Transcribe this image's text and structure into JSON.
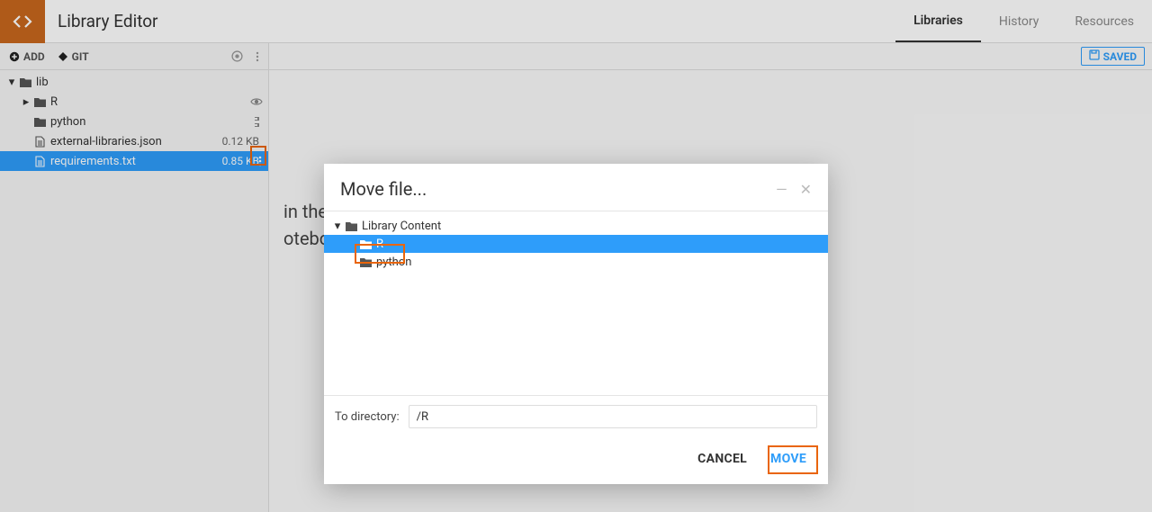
{
  "header": {
    "title": "Library Editor",
    "tabs": [
      {
        "label": "Libraries",
        "active": true
      },
      {
        "label": "History",
        "active": false
      },
      {
        "label": "Resources",
        "active": false
      }
    ]
  },
  "sidebar": {
    "actions": {
      "add": "ADD",
      "git": "GIT"
    },
    "tree": {
      "root": {
        "name": "lib"
      },
      "items": [
        {
          "name": "R",
          "type": "folder",
          "badge_icon": "eye-icon"
        },
        {
          "name": "python",
          "type": "folder",
          "badge_icon": "python-icon"
        },
        {
          "name": "external-libraries.json",
          "type": "file",
          "size": "0.12 KB"
        },
        {
          "name": "requirements.txt",
          "type": "file",
          "size": "0.85 KB",
          "selected": true
        }
      ]
    }
  },
  "main": {
    "saved_label": "SAVED",
    "body_line1": "in the project. These will be",
    "body_line2": "otebooks"
  },
  "modal": {
    "title": "Move file...",
    "tree": {
      "root": "Library Content",
      "items": [
        {
          "name": "R",
          "selected": true
        },
        {
          "name": "python",
          "selected": false
        }
      ]
    },
    "input_label": "To directory:",
    "input_value": "/R",
    "cancel_label": "CANCEL",
    "move_label": "MOVE"
  },
  "icons": {
    "chev_down": "▾",
    "chev_right": "▸"
  }
}
